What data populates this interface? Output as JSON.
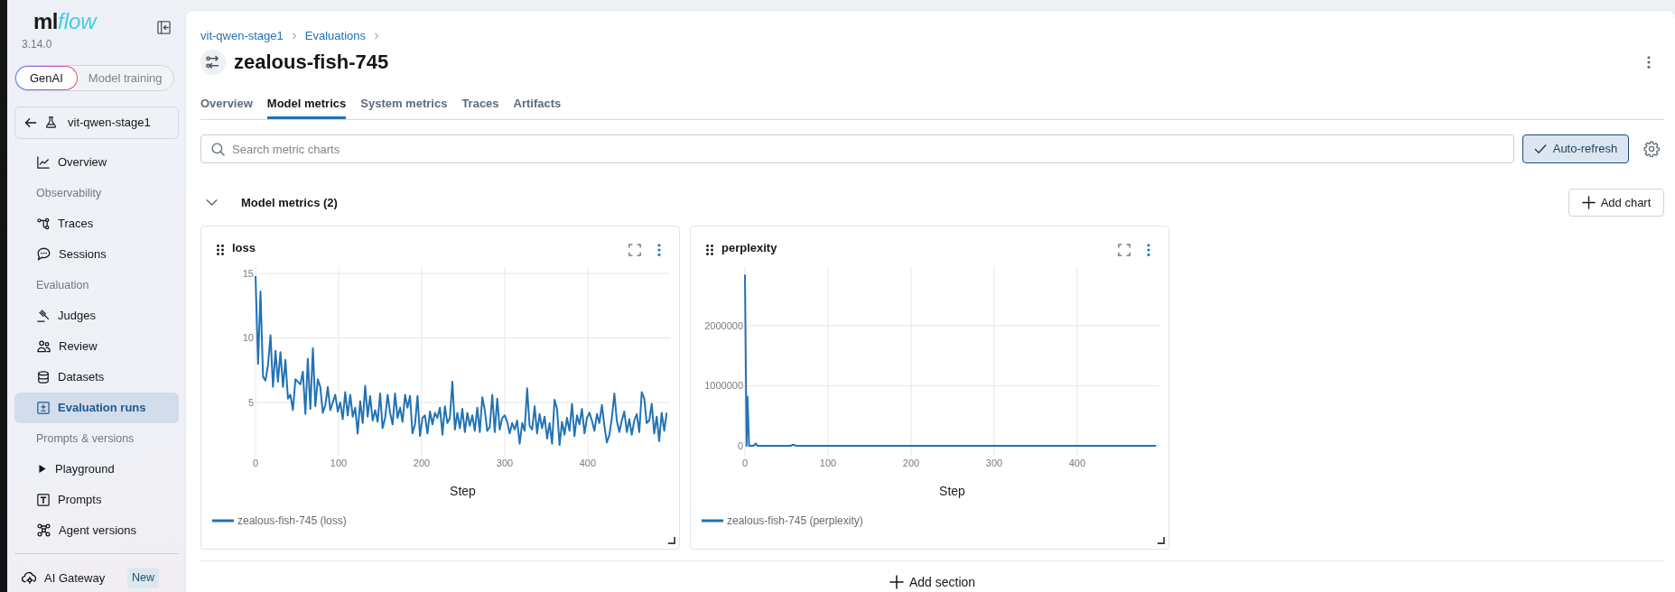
{
  "sidebar": {
    "logo": {
      "text": "ml",
      "accent": "flow"
    },
    "version": "3.14.0",
    "mode_toggle": [
      {
        "label": "GenAI",
        "selected": true
      },
      {
        "label": "Model training",
        "selected": false
      }
    ],
    "experiment": "vit-qwen-stage1",
    "nav": [
      {
        "kind": "link",
        "label": "Overview",
        "selected": false
      },
      {
        "kind": "heading",
        "label": "Observability"
      },
      {
        "kind": "link",
        "label": "Traces",
        "selected": false
      },
      {
        "kind": "link",
        "label": "Sessions",
        "selected": false
      },
      {
        "kind": "heading",
        "label": "Evaluation"
      },
      {
        "kind": "link",
        "label": "Judges",
        "selected": false
      },
      {
        "kind": "link",
        "label": "Review",
        "selected": false
      },
      {
        "kind": "link",
        "label": "Datasets",
        "selected": false
      },
      {
        "kind": "link",
        "label": "Evaluation runs",
        "selected": true
      },
      {
        "kind": "heading",
        "label": "Prompts & versions"
      },
      {
        "kind": "link",
        "label": "Playground",
        "selected": false
      },
      {
        "kind": "link",
        "label": "Prompts",
        "selected": false
      },
      {
        "kind": "link",
        "label": "Agent versions",
        "selected": false
      }
    ],
    "footer": {
      "label": "AI Gateway",
      "badge": "New"
    }
  },
  "header": {
    "breadcrumb": [
      "vit-qwen-stage1",
      "Evaluations"
    ],
    "title": "zealous-fish-745"
  },
  "tabs": [
    {
      "label": "Overview",
      "selected": false
    },
    {
      "label": "Model metrics",
      "selected": true
    },
    {
      "label": "System metrics",
      "selected": false
    },
    {
      "label": "Traces",
      "selected": false
    },
    {
      "label": "Artifacts",
      "selected": false
    }
  ],
  "toolbar": {
    "search": {
      "placeholder": "Search metric charts"
    },
    "auto_refresh": {
      "label": "Auto-refresh",
      "checked": true
    }
  },
  "section": {
    "title": "Model metrics (2)",
    "expanded": true,
    "add_chart": "Add chart",
    "charts": [
      {
        "chart_data": {
          "type": "line",
          "title": "loss",
          "xlabel": "Step",
          "x": [
            0,
            3,
            6,
            9,
            12,
            15,
            18,
            21,
            24,
            27,
            30,
            33,
            36,
            39,
            42,
            45,
            48,
            51,
            54,
            57,
            60,
            63,
            66,
            69,
            72,
            75,
            78,
            81,
            84,
            87,
            90,
            93,
            96,
            99,
            102,
            105,
            108,
            111,
            114,
            117,
            120,
            123,
            126,
            129,
            132,
            135,
            138,
            141,
            144,
            147,
            150,
            153,
            156,
            159,
            162,
            165,
            168,
            171,
            174,
            177,
            180,
            183,
            186,
            189,
            192,
            195,
            198,
            201,
            204,
            207,
            210,
            213,
            216,
            219,
            222,
            225,
            228,
            231,
            234,
            237,
            240,
            243,
            246,
            249,
            252,
            255,
            258,
            261,
            264,
            267,
            270,
            273,
            276,
            279,
            282,
            285,
            288,
            291,
            294,
            297,
            300,
            303,
            306,
            309,
            312,
            315,
            318,
            321,
            324,
            327,
            330,
            333,
            336,
            339,
            342,
            345,
            348,
            351,
            354,
            357,
            360,
            363,
            366,
            369,
            372,
            375,
            378,
            381,
            384,
            387,
            390,
            393,
            396,
            399,
            402,
            405,
            408,
            411,
            414,
            417,
            420,
            423,
            426,
            429,
            432,
            435,
            438,
            441,
            444,
            447,
            450,
            453,
            456,
            459,
            462,
            465,
            468,
            471,
            474,
            477,
            480,
            483,
            486,
            489,
            492,
            495
          ],
          "series": [
            {
              "name": "zealous-fish-745 (loss)",
              "color": "#2272b4",
              "values": [
                14.8,
                8.0,
                13.6,
                7.0,
                6.7,
                7.9,
                10.2,
                6.2,
                9.0,
                6.6,
                8.9,
                6.2,
                8.3,
                5.3,
                5.6,
                4.4,
                6.8,
                6.6,
                6.4,
                7.4,
                4.1,
                8.4,
                4.5,
                9.2,
                4.7,
                6.8,
                6.2,
                4.2,
                4.8,
                6.2,
                4.4,
                5.0,
                5.6,
                4.3,
                5.0,
                3.7,
                5.8,
                4.0,
                5.6,
                3.9,
                4.6,
                2.6,
                5.1,
                3.4,
                6.3,
                3.9,
                5.5,
                3.6,
                4.4,
                3.5,
                5.7,
                3.0,
                3.8,
                5.6,
                4.2,
                3.3,
                5.7,
                3.8,
                4.6,
                3.5,
                5.6,
                4.6,
                5.5,
                2.6,
                3.3,
                5.5,
                2.4,
                3.8,
                4.0,
                2.6,
                4.3,
                3.3,
                4.2,
                3.8,
                4.6,
                2.5,
                4.7,
                3.4,
                3.8,
                6.6,
                2.9,
                4.2,
                3.0,
                4.5,
                2.7,
                4.2,
                3.2,
                4.0,
                2.8,
                4.6,
                2.7,
                5.4,
                4.4,
                2.8,
                3.1,
                5.6,
                2.7,
                5.3,
                2.9,
                3.8,
                4.0,
                3.5,
                2.6,
                3.4,
                2.9,
                3.6,
                1.8,
                3.4,
                2.8,
                6.1,
                3.2,
                2.9,
                4.7,
                2.6,
                4.1,
                3.0,
                3.9,
                2.2,
                3.4,
                1.8,
                5.2,
                4.5,
                1.7,
                3.5,
                2.5,
                3.8,
                2.8,
                4.9,
                2.4,
                4.0,
                3.3,
                4.5,
                2.6,
                3.8,
                4.2,
                3.6,
                2.8,
                4.1,
                3.4,
                4.8,
                3.2,
                1.9,
                2.5,
                3.8,
                5.7,
                3.6,
                2.7,
                3.6,
                4.3,
                2.7,
                3.7,
                2.5,
                3.6,
                4.1,
                2.7,
                5.8,
                5.3,
                3.4,
                3.6,
                4.9,
                2.6,
                3.9,
                2.0,
                4.2,
                2.8,
                4.2
              ]
            }
          ],
          "xlim": [
            0,
            499
          ],
          "ylim": [
            0.8,
            15.56
          ],
          "xticks": [
            0,
            100,
            200,
            300,
            400
          ],
          "yticks": [
            5,
            10,
            15
          ],
          "grid": true
        }
      },
      {
        "chart_data": {
          "type": "line",
          "title": "perplexity",
          "xlabel": "Step",
          "x": [
            0,
            2,
            3,
            5,
            10,
            13,
            15,
            55,
            58,
            62,
            495
          ],
          "series": [
            {
              "name": "zealous-fish-745 (perplexity)",
              "color": "#2272b4",
              "values": [
                2850000,
                0,
                820000,
                0,
                0,
                40000,
                0,
                0,
                20000,
                0,
                0
              ]
            }
          ],
          "xlim": [
            0,
            499
          ],
          "ylim": [
            -180000,
            2990000
          ],
          "xticks": [
            0,
            100,
            200,
            300,
            400
          ],
          "yticks": [
            0,
            1000000,
            2000000
          ],
          "grid": true
        }
      }
    ]
  },
  "add_section": "Add section"
}
